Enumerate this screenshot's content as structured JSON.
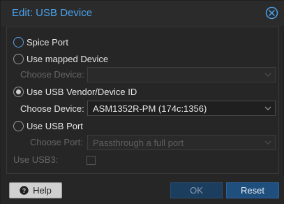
{
  "dialog": {
    "title": "Edit: USB Device"
  },
  "options": {
    "spice_port": "Spice Port",
    "mapped_device": "Use mapped Device",
    "vendor_device": "Use USB Vendor/Device ID",
    "usb_port": "Use USB Port"
  },
  "mapped": {
    "label": "Choose Device:",
    "value": ""
  },
  "vendor": {
    "label": "Choose Device:",
    "value": "ASM1352R-PM (174c:1356)"
  },
  "port": {
    "label": "Choose Port:",
    "value": "Passthrough a full port"
  },
  "usb3": {
    "label": "Use USB3:"
  },
  "buttons": {
    "help": "Help",
    "ok": "OK",
    "reset": "Reset"
  },
  "colors": {
    "accent": "#4aa3ef",
    "reset_button": "#1f4f7c",
    "ok_button_disabled": "#1b3e5e"
  },
  "icons": {
    "close": "close-circle-icon",
    "help": "question-circle-icon",
    "dropdown": "chevron-down-icon"
  }
}
